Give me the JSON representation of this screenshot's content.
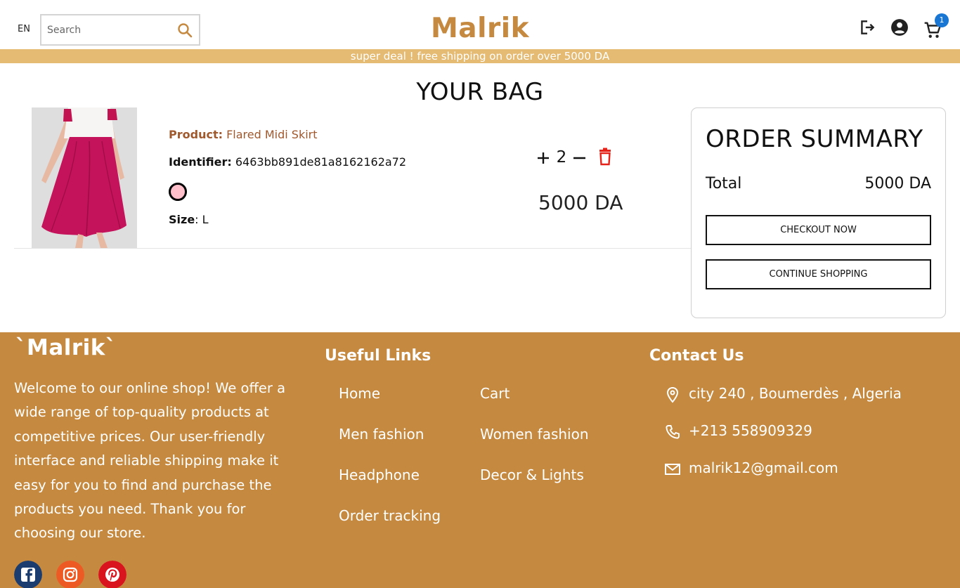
{
  "header": {
    "language": "EN",
    "search_placeholder": "Search",
    "brand": "Malrik",
    "cart_count": "1",
    "icons": [
      "search-icon",
      "logout-icon",
      "account-icon",
      "cart-icon"
    ]
  },
  "promo": "super deal ! free shipping on order over 5000 DA",
  "main": {
    "title": "YOUR BAG",
    "items": [
      {
        "product_label": "Product:",
        "product_name": "Flared Midi Skirt",
        "identifier_label": "Identifier:",
        "identifier": "6463bb891de81a8162162a72",
        "color": "#ffc0cb",
        "size_label": "Size",
        "size": "L",
        "quantity": "2",
        "price": "5000 DA"
      }
    ]
  },
  "summary": {
    "title": "ORDER SUMMARY",
    "total_label": "Total",
    "total_value": "5000 DA",
    "checkout_label": "CHECKOUT NOW",
    "continue_label": "CONTINUE SHOPPING"
  },
  "footer": {
    "brand": "`Malrik`",
    "description": "Welcome to our online shop! We offer a wide range of top-quality products at competitive prices. Our user-friendly interface and reliable shipping make it easy for you to find and purchase the products you need. Thank you for choosing our store.",
    "links_title": "Useful Links",
    "links": [
      "Home",
      "Cart",
      "Men fashion",
      "Women fashion",
      "Headphone",
      "Decor & Lights",
      "Order tracking"
    ],
    "contact_title": "Contact Us",
    "address": "city 240 , Boumerdès , Algeria",
    "phone": "+213 558909329",
    "email": "malrik12@gmail.com",
    "socials": [
      "facebook-icon",
      "instagram-icon",
      "pinterest-icon"
    ]
  },
  "colors": {
    "brand": "#c58940",
    "promo_bar": "#e5ba73",
    "product_name": "#a0582d",
    "delete": "#e5231b",
    "badge": "#1976d2"
  }
}
